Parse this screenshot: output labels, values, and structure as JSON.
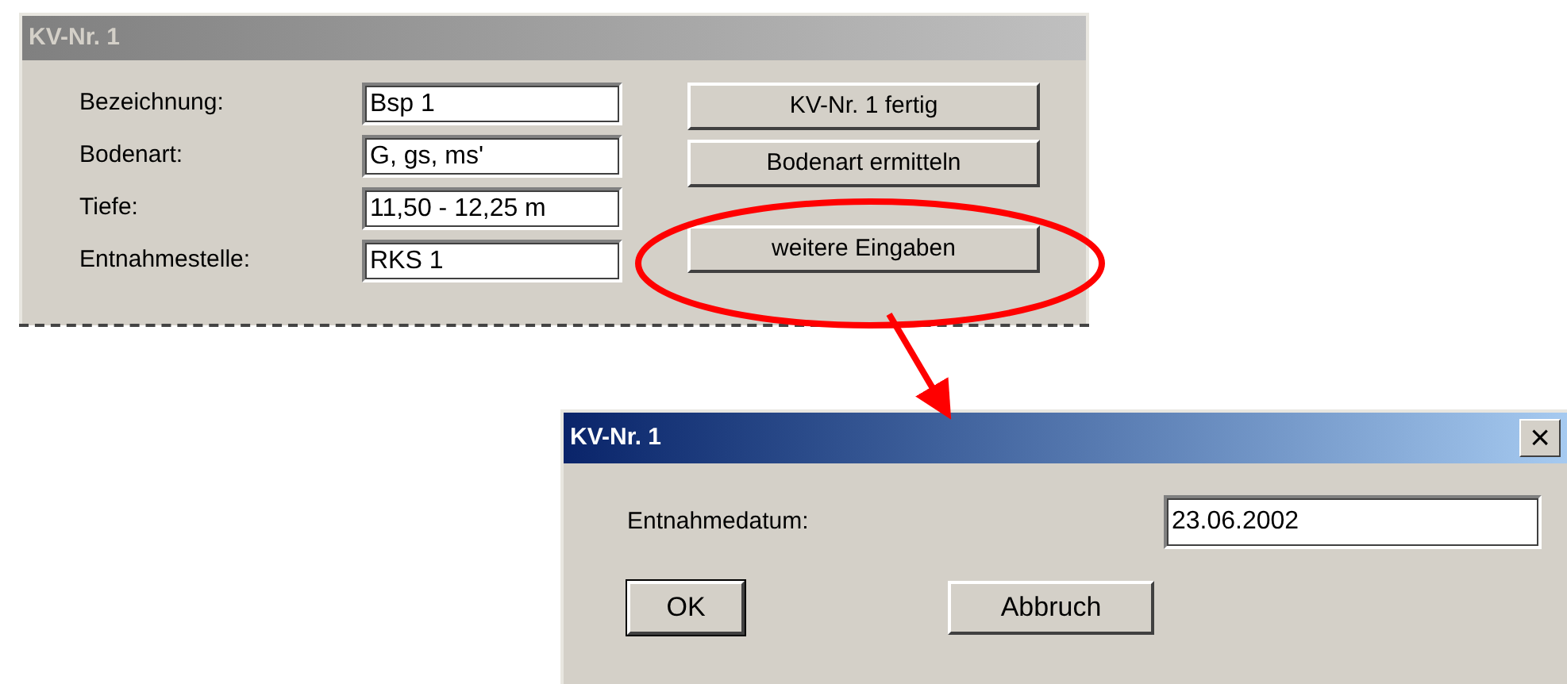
{
  "main_window": {
    "title": "KV-Nr. 1",
    "active": false,
    "fields": [
      {
        "label": "Bezeichnung:",
        "value": "Bsp 1"
      },
      {
        "label": "Bodenart:",
        "value": "G, gs, ms'"
      },
      {
        "label": "Tiefe:",
        "value": "11,50 - 12,25 m"
      },
      {
        "label": "Entnahmestelle:",
        "value": "RKS 1"
      }
    ],
    "buttons": [
      {
        "label": "KV-Nr. 1 fertig"
      },
      {
        "label": "Bodenart ermitteln"
      },
      {
        "label": "weitere Eingaben"
      }
    ]
  },
  "dialog": {
    "title": "KV-Nr. 1",
    "active": true,
    "close": "×",
    "fields": [
      {
        "label": "Entnahmedatum:",
        "value": "23.06.2002"
      }
    ],
    "buttons": [
      {
        "label": "OK",
        "default": true
      },
      {
        "label": "Abbruch",
        "default": false
      }
    ]
  }
}
